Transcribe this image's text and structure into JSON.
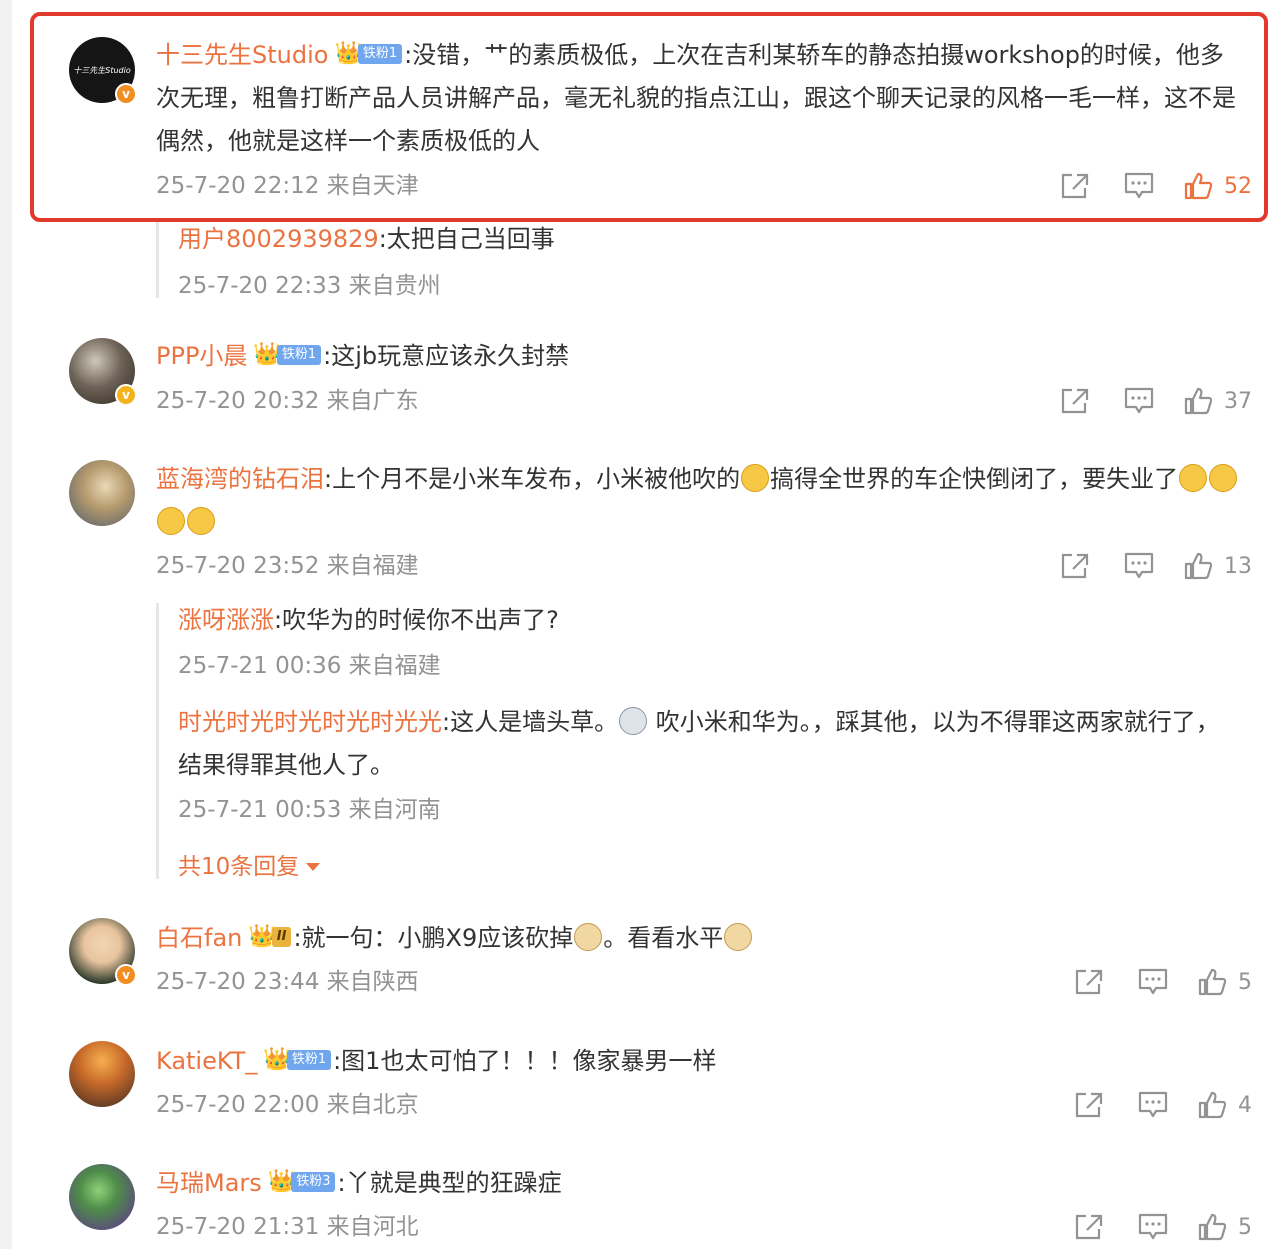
{
  "comments": [
    {
      "user": "十三先生Studio",
      "avatar_text": "十三先生Studio",
      "verified": "v",
      "badge_tag": "铁粉1",
      "text": ":没错，艹的素质极低，上次在吉利某轿车的静态拍摄workshop的时候，他多次无理，粗鲁打断产品人员讲解产品，毫无礼貌的指点江山，跟这个聊天记录的风格一毛一样，这不是偶然，他就是这样一个素质极低的人",
      "time": "25-7-20 22:12 来自天津",
      "likes": "52",
      "sub_replies": [
        {
          "user": "用户8002939829",
          "text": ":太把自己当回事",
          "time": "25-7-20 22:33 来自贵州"
        }
      ]
    },
    {
      "user": "PPP小晨",
      "verified": "v",
      "badge_tag": "铁粉1",
      "text": ":这jb玩意应该永久封禁",
      "time": "25-7-20 20:32 来自广东",
      "likes": "37"
    },
    {
      "user": "蓝海湾的钻石泪",
      "text_part1": ":上个月不是小米车发布，小米被他吹的",
      "text_part2": "搞得全世界的车企快倒闭了，要失业了",
      "time": "25-7-20 23:52 来自福建",
      "likes": "13",
      "sub_replies": [
        {
          "user": "涨呀涨涨",
          "text": ":吹华为的时候你不出声了?",
          "time": "25-7-21 00:36 来自福建"
        },
        {
          "user": "时光时光时光时光时光光",
          "text_part1": ":这人是墙头草。",
          "text_part2": " 吹小米和华为。，踩其他，以为不得罪这两家就行了，结果得罪其他人了。",
          "time": "25-7-21 00:53 来自河南"
        }
      ],
      "more_replies": "共10条回复"
    },
    {
      "user": "白石fan",
      "verified": "v",
      "badge_tag": "II",
      "text_part1": ":就一句：小鹏X9应该砍掉",
      "text_part2": "。看看水平",
      "time": "25-7-20 23:44 来自陕西",
      "likes": "5"
    },
    {
      "user": "KatieKT_",
      "badge_tag": "铁粉1",
      "text": ":图1也太可怕了！！！像家暴男一样",
      "time": "25-7-20 22:00 来自北京",
      "likes": "4"
    },
    {
      "user": "马瑞Mars",
      "badge_tag": "铁粉3",
      "text": ":丫就是典型的狂躁症",
      "time": "25-7-20 21:31 来自河北",
      "likes": "5"
    }
  ],
  "colors": {
    "username": "#eb7340",
    "meta": "#939393",
    "highlight": "#e2392d",
    "fan_tag": "#6fa6ee",
    "verified_orange": "#f28d1f",
    "verified_gold": "#f3b31d"
  },
  "icons": [
    "share-icon",
    "comment-icon",
    "thumbs-up-icon",
    "crown-icon",
    "caret-down-icon"
  ]
}
